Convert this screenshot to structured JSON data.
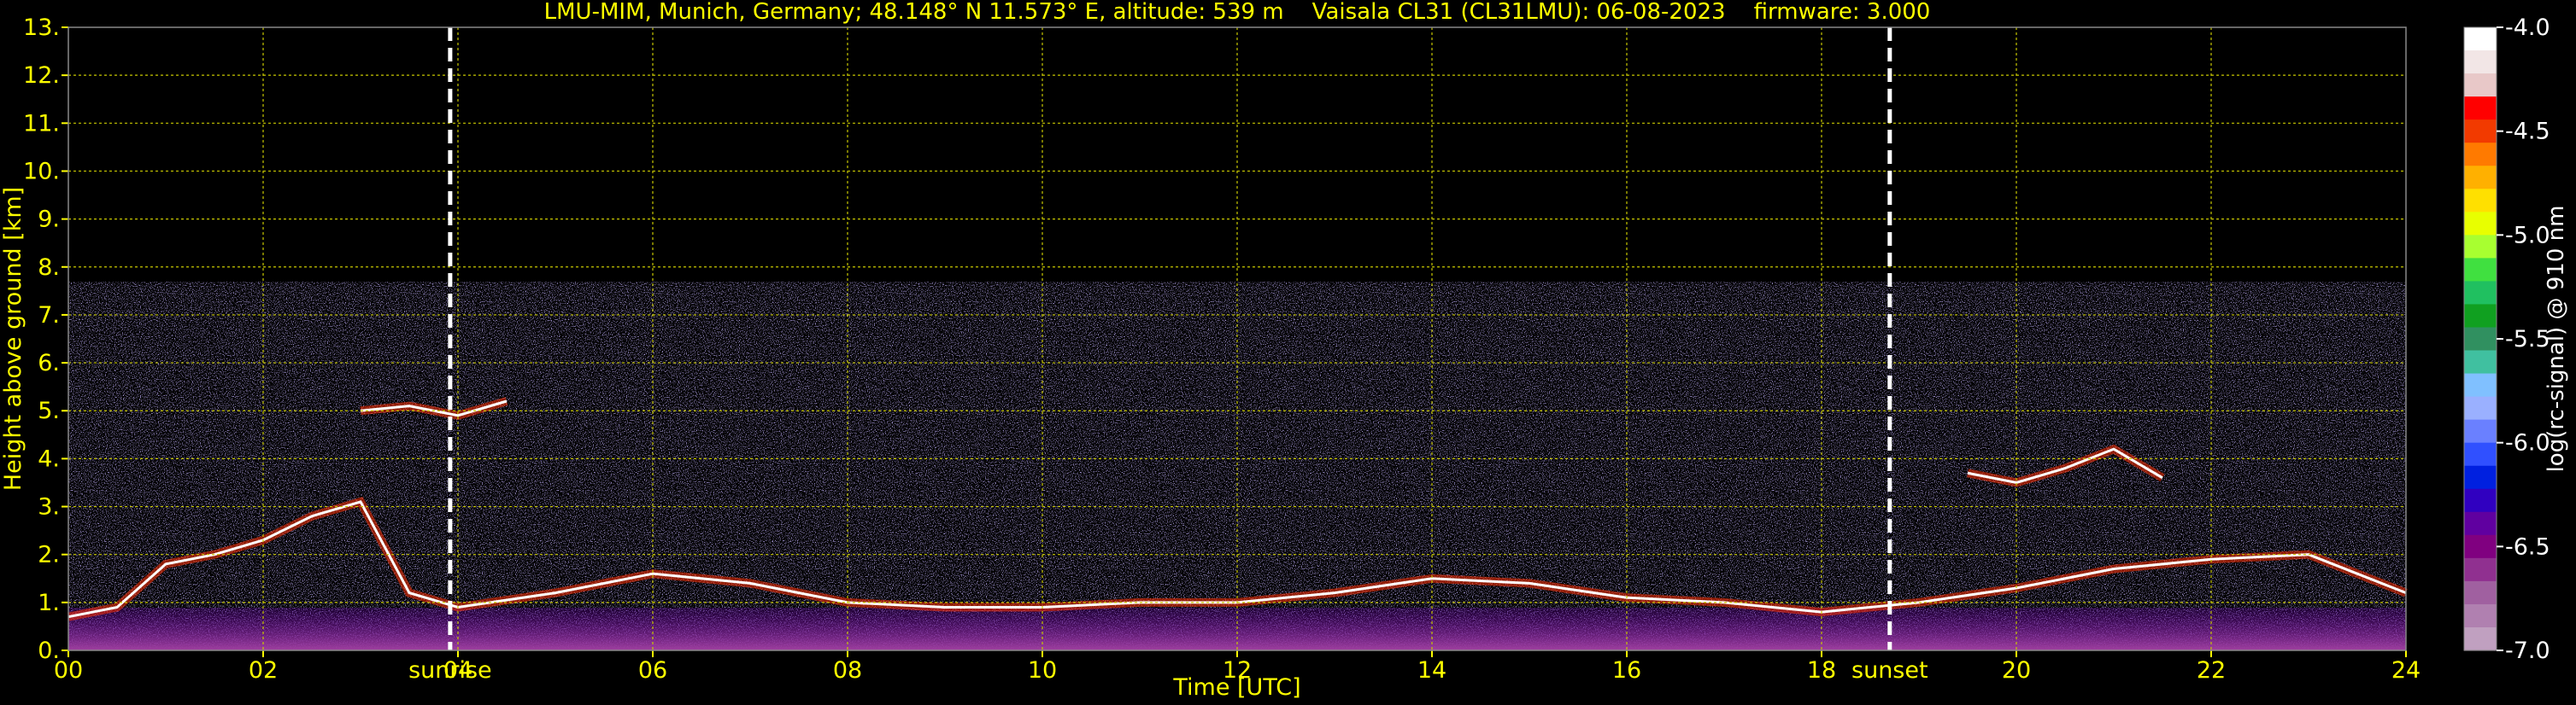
{
  "chart_data": {
    "type": "heatmap",
    "title": "LMU-MIM, Munich, Germany; 48.148° N 11.573° E, altitude: 539 m    Vaisala CL31 (CL31LMU): 06-08-2023    firmware: 3.000",
    "xlabel": "Time [UTC]",
    "ylabel": "Height above ground [km]",
    "xlim": [
      0,
      24
    ],
    "ylim": [
      0,
      13
    ],
    "x_ticks": [
      "00",
      "02",
      "04",
      "06",
      "08",
      "10",
      "12",
      "14",
      "16",
      "18",
      "20",
      "22",
      "24"
    ],
    "y_ticks": [
      "0.",
      "1.",
      "2.",
      "3.",
      "4.",
      "5.",
      "6.",
      "7.",
      "8.",
      "9.",
      "10.",
      "11.",
      "12.",
      "13."
    ],
    "grid": true,
    "events": [
      {
        "label": "sunrise",
        "time": 3.92
      },
      {
        "label": "sunset",
        "time": 18.7
      }
    ],
    "colorbar": {
      "label": "log(rc-signal) @ 910 nm",
      "range": [
        -7.0,
        -4.0
      ],
      "ticks": [
        "-4.0",
        "-4.5",
        "-5.0",
        "-5.5",
        "-6.0",
        "-6.5",
        "-7.0"
      ],
      "colors": [
        "#ffffff",
        "#f2e6e6",
        "#e8c8c8",
        "#ff0000",
        "#f23a00",
        "#ff7a00",
        "#ffb000",
        "#ffe000",
        "#e8ff00",
        "#a8ff30",
        "#40e040",
        "#20c060",
        "#10a020",
        "#309060",
        "#40c0a0",
        "#80c0ff",
        "#9ab0ff",
        "#6a80ff",
        "#3050ff",
        "#0020e0",
        "#3000c0",
        "#6000a0",
        "#800080",
        "#903090",
        "#a060a0",
        "#b080b0",
        "#c0a0c0"
      ]
    },
    "features": [
      {
        "name": "boundary layer",
        "x": [
          0,
          0.5,
          1,
          1.5,
          2,
          2.5,
          3,
          3.5,
          4,
          5,
          6,
          7,
          8,
          9,
          10,
          11,
          12,
          13,
          14,
          15,
          16,
          17,
          18,
          19,
          20,
          21,
          22,
          23,
          24
        ],
        "y": [
          0.7,
          0.9,
          1.8,
          2.0,
          2.3,
          2.8,
          3.1,
          1.2,
          0.9,
          1.2,
          1.6,
          1.4,
          1.0,
          0.9,
          0.9,
          1.0,
          1.0,
          1.2,
          1.5,
          1.4,
          1.1,
          1.0,
          0.8,
          1.0,
          1.3,
          1.7,
          1.9,
          2.0,
          1.2
        ]
      },
      {
        "name": "cloud layer",
        "x": [
          3.0,
          3.5,
          4.0,
          4.5
        ],
        "y": [
          5.0,
          5.1,
          4.9,
          5.2
        ]
      },
      {
        "name": "cloud layer",
        "x": [
          19.5,
          20.0,
          20.5,
          21.0,
          21.5
        ],
        "y": [
          3.7,
          3.5,
          3.8,
          4.2,
          3.6
        ]
      }
    ]
  }
}
